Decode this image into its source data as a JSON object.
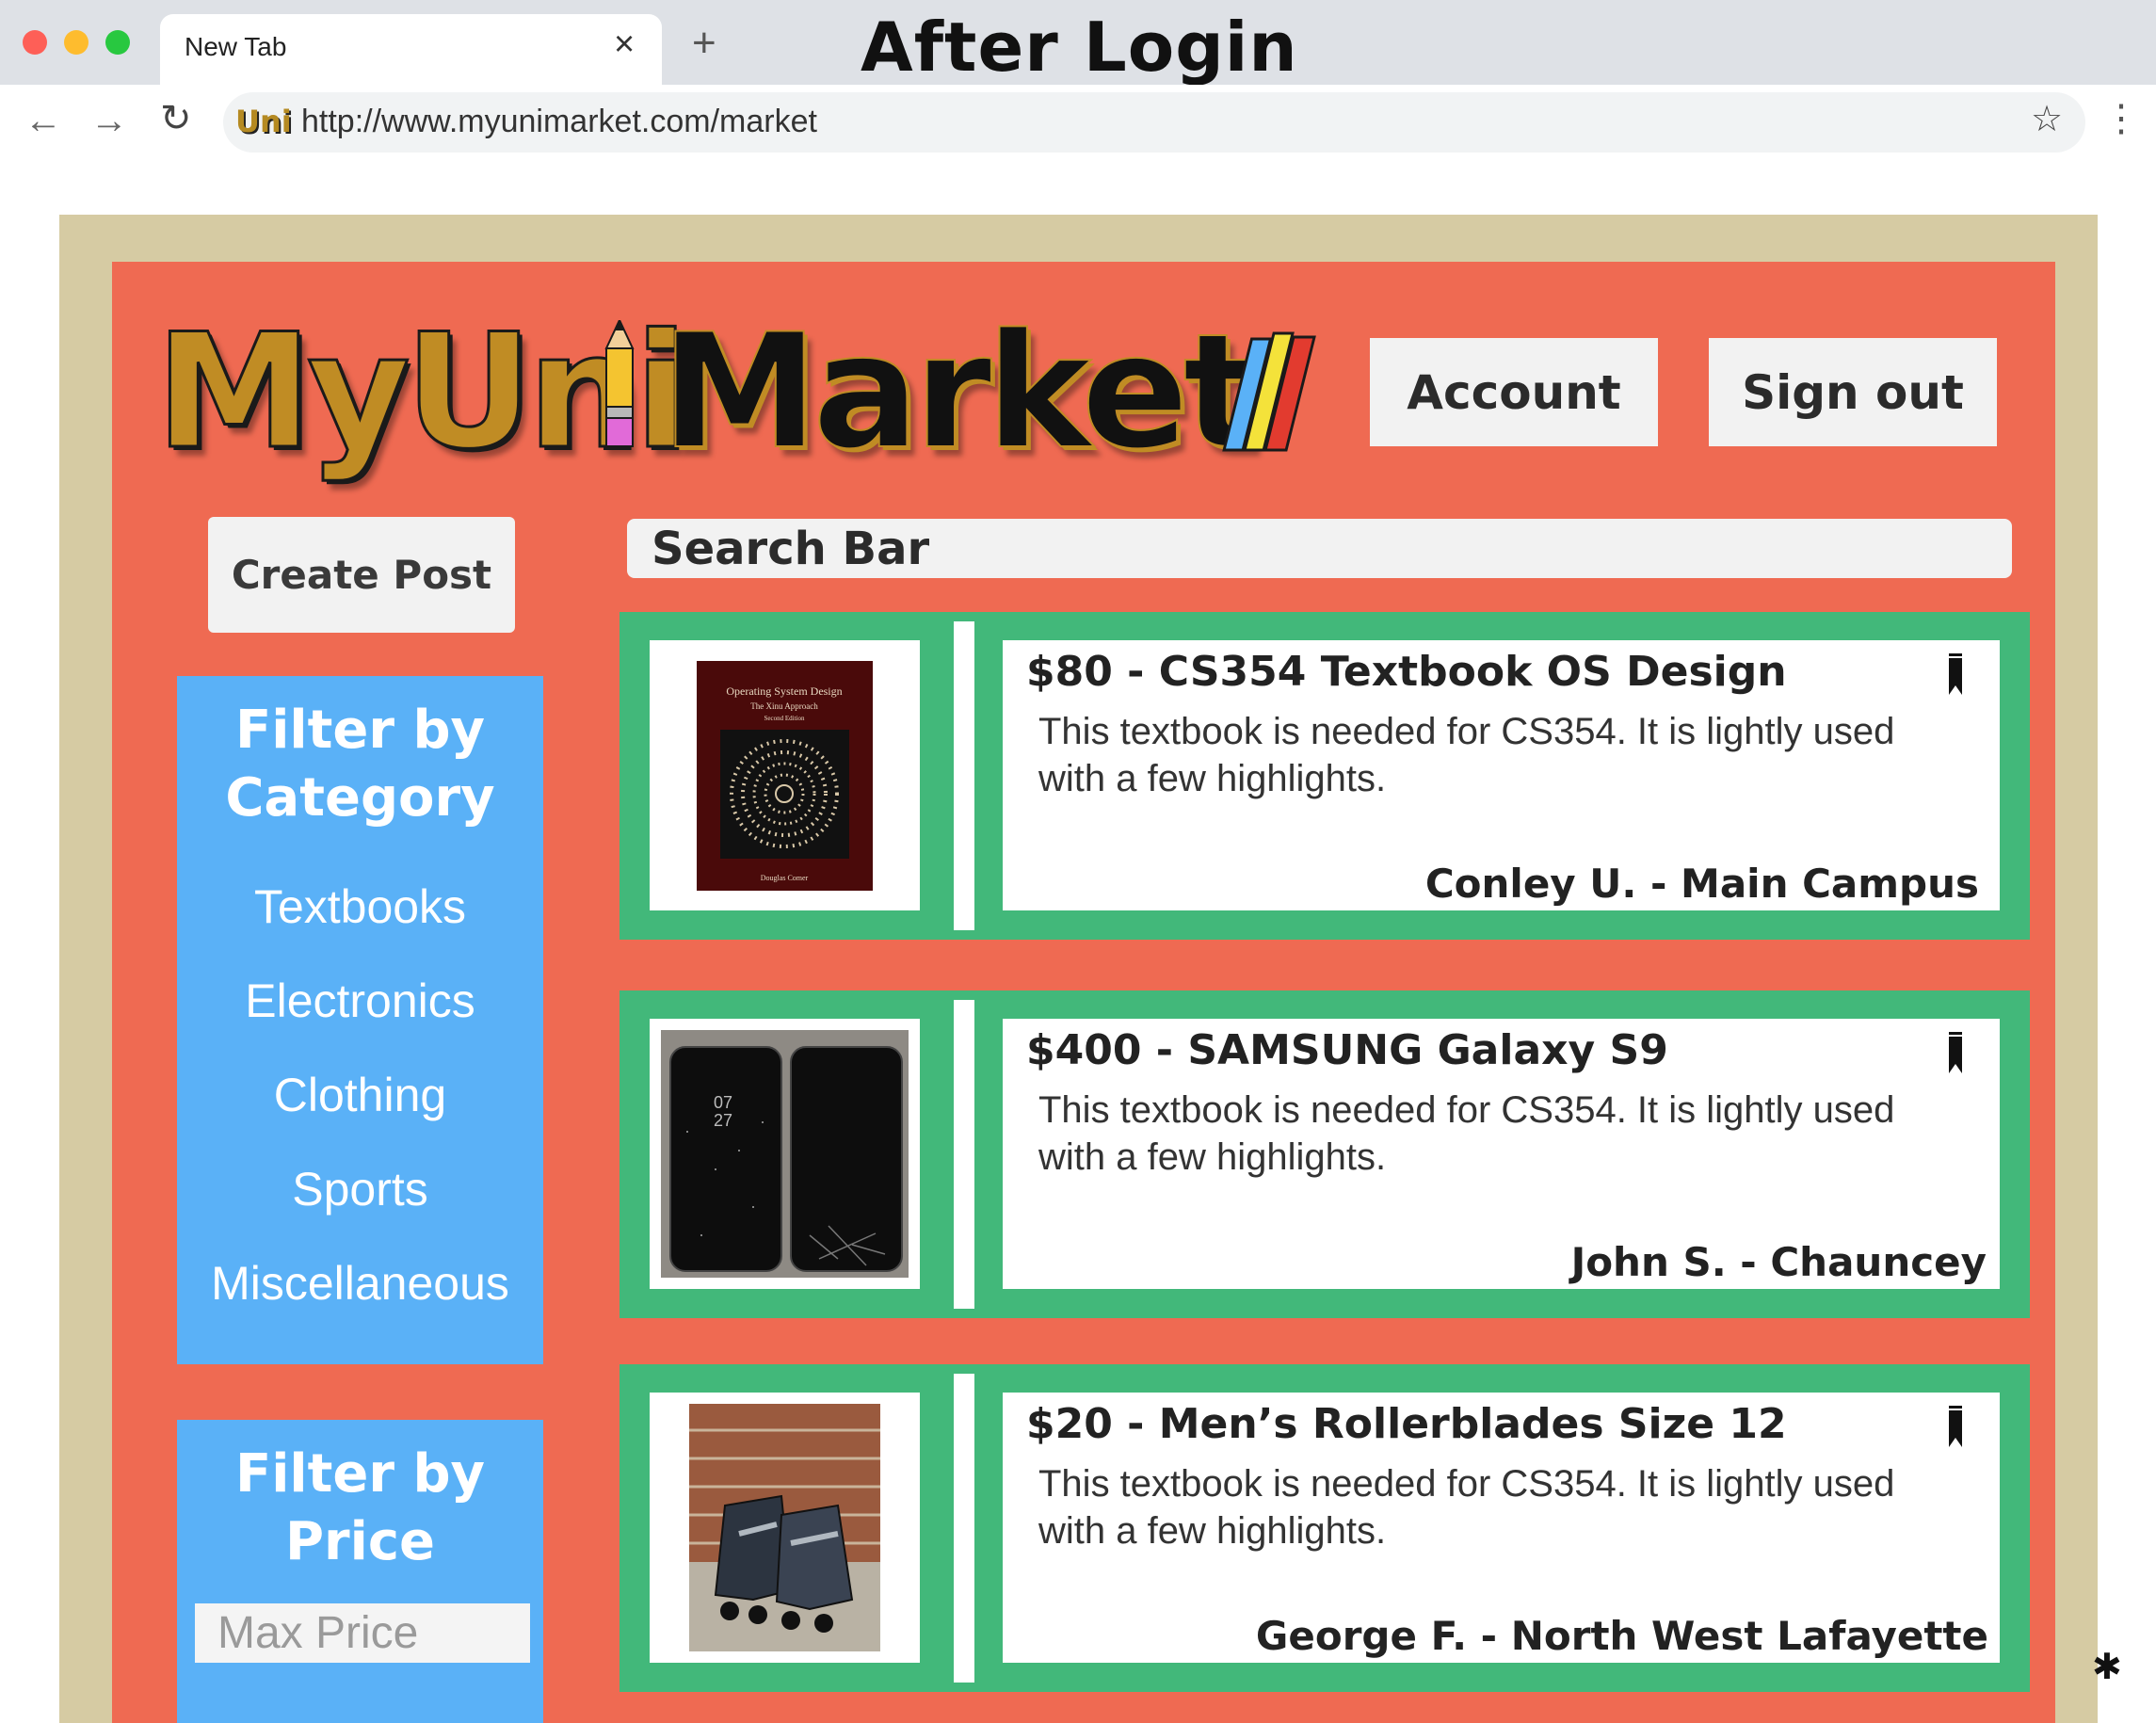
{
  "annotation": "After Login",
  "browser": {
    "tab_title": "New Tab",
    "tab_close": "×",
    "new_tab": "+",
    "url_logo": "Uni",
    "url": "http://www.myunimarket.com/market",
    "window_controls": {
      "close": "#fe5f57",
      "minimize": "#febc2e",
      "maximize": "#28c840"
    }
  },
  "header": {
    "logo_part1": "MyUni",
    "logo_part2": "Market",
    "account_label": "Account",
    "signout_label": "Sign out"
  },
  "sidebar": {
    "create_post_label": "Create Post",
    "category_filter": {
      "title_line1": "Filter by",
      "title_line2": "Category",
      "items": [
        "Textbooks",
        "Electronics",
        "Clothing",
        "Sports",
        "Miscellaneous"
      ]
    },
    "price_filter": {
      "title_line1": "Filter by",
      "title_line2": "Price",
      "max_price_placeholder": "Max Price"
    }
  },
  "search": {
    "label": "Search Bar"
  },
  "listings": [
    {
      "title": "$80 - CS354 Textbook OS Design",
      "description": "This textbook is needed for CS354. It is lightly used with a few highlights.",
      "seller": "Conley U. - Main Campus",
      "image": "textbook-cover",
      "image_text": {
        "title": "Operating System Design",
        "subtitle": "The Xinu Approach",
        "edition": "Second Edition",
        "author": "Douglas Comer"
      }
    },
    {
      "title": "$400 - SAMSUNG Galaxy S9",
      "description": "This textbook is needed for CS354. It is lightly used with a few highlights.",
      "seller": "John S. - Chauncey",
      "image": "two-phones-photo",
      "image_text": {
        "clock": "07\n27"
      }
    },
    {
      "title": "$20 - Men’s Rollerblades Size 12",
      "description": "This textbook is needed for CS354. It is lightly used with a few highlights.",
      "seller": "George F. - North West Lafayette",
      "image": "rollerblades-photo"
    }
  ],
  "colors": {
    "frame": "#d6cba3",
    "page_bg": "#ef6a52",
    "card_border": "#42b87a",
    "filter_bg": "#5ab1f7",
    "logo_gold": "#c08c24"
  }
}
